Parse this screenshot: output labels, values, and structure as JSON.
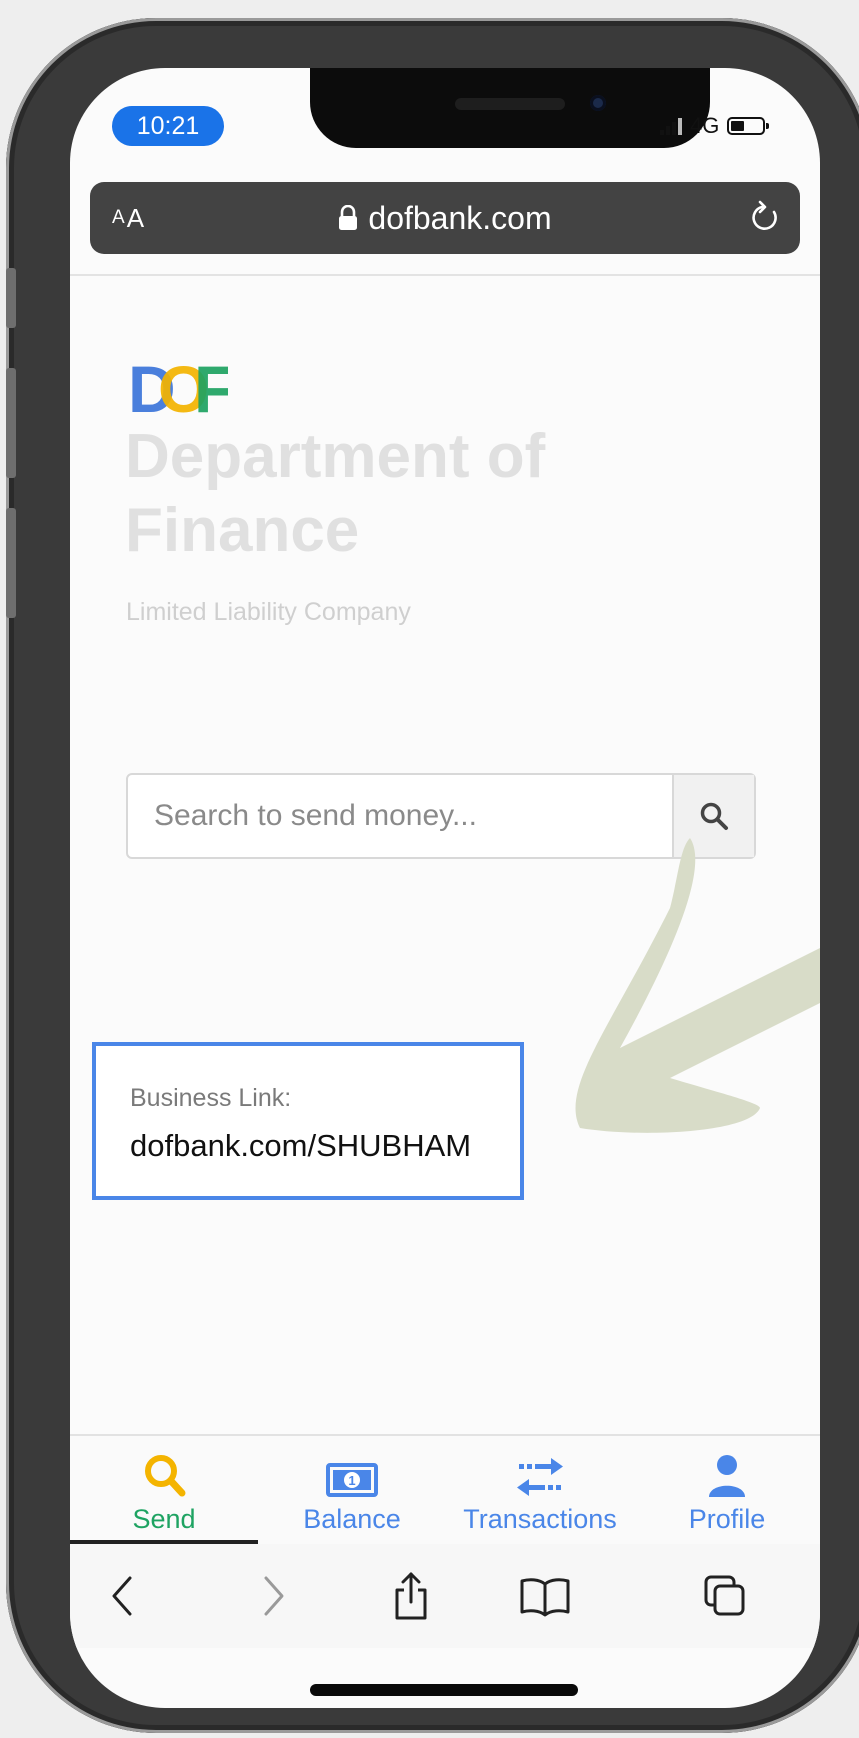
{
  "status_bar": {
    "time": "10:21",
    "network": "4G"
  },
  "browser": {
    "text_size_small": "A",
    "text_size_large": "A",
    "url": "dofbank.com"
  },
  "brand": {
    "logo_letters": [
      "D",
      "O",
      "F"
    ],
    "logo_colors": [
      "#4a7fdc",
      "#f4b400",
      "#1ea362"
    ],
    "org_name": "Department of Finance",
    "org_subtitle": "Limited Liability Company"
  },
  "search": {
    "placeholder": "Search to send money..."
  },
  "business": {
    "label": "Business Link:",
    "link": "dofbank.com/SHUBHAM"
  },
  "tabs": [
    {
      "label": "Send",
      "icon": "search-icon",
      "color": "#1ea362",
      "active": true
    },
    {
      "label": "Balance",
      "icon": "banknote-icon",
      "color": "#4a86e8"
    },
    {
      "label": "Transactions",
      "icon": "transfer-arrows-icon",
      "color": "#4a86e8"
    },
    {
      "label": "Profile",
      "icon": "user-icon",
      "color": "#4a86e8"
    }
  ],
  "toolbar": [
    "back-icon",
    "forward-icon",
    "share-icon",
    "bookmarks-icon",
    "tabs-icon"
  ],
  "colors": {
    "accent_blue": "#4a86e8",
    "send_icon": "#f4b400",
    "arrow": "#d8dcc8"
  }
}
